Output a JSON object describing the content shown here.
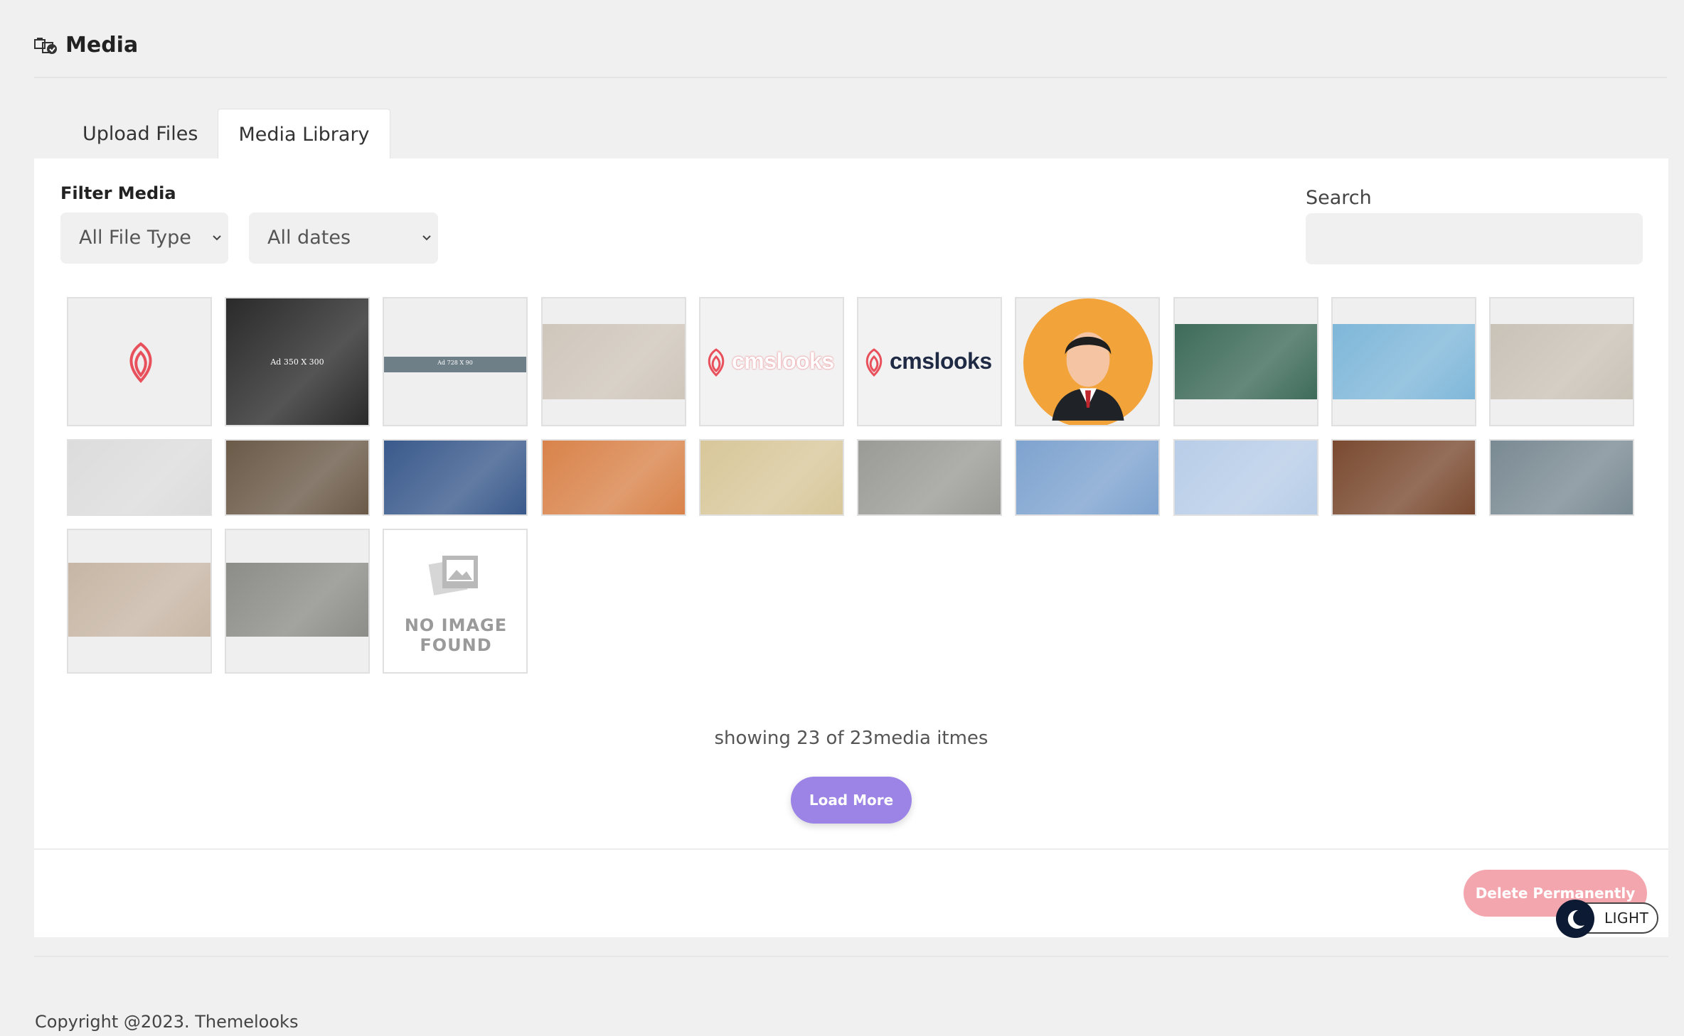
{
  "header": {
    "title": "Media",
    "icon": "media-icon"
  },
  "tabs": [
    {
      "label": "Upload Files",
      "active": false
    },
    {
      "label": "Media Library",
      "active": true
    }
  ],
  "filter": {
    "label": "Filter Media",
    "file_type": "All File Type",
    "dates": "All dates"
  },
  "search": {
    "label": "Search",
    "placeholder": "",
    "value": ""
  },
  "media": {
    "items": [
      {
        "kind": "logo-mark",
        "bg": "#efefef"
      },
      {
        "kind": "photo",
        "bg": "#2a2a2a",
        "label": "Ad 350 X 300"
      },
      {
        "kind": "banner",
        "bg": "#efefef",
        "label": "Ad 728 X 90"
      },
      {
        "kind": "photo",
        "bg": "#cfc6bb"
      },
      {
        "kind": "logo-text",
        "bg": "#f2f2f2",
        "label": "cmslooks"
      },
      {
        "kind": "logo-text",
        "bg": "#f2f2f2",
        "label": "cmslooks"
      },
      {
        "kind": "avatar",
        "bg": "#efefef"
      },
      {
        "kind": "photo",
        "bg": "#3e6b5a"
      },
      {
        "kind": "photo",
        "bg": "#7fb7d9"
      },
      {
        "kind": "photo",
        "bg": "#c9c2b7"
      },
      {
        "kind": "photo",
        "bg": "#dcdcdc"
      },
      {
        "kind": "photo",
        "bg": "#6b5a48"
      },
      {
        "kind": "photo",
        "bg": "#3a5a8c"
      },
      {
        "kind": "photo",
        "bg": "#d9834a"
      },
      {
        "kind": "photo",
        "bg": "#d8c79a"
      },
      {
        "kind": "photo",
        "bg": "#9a9a96"
      },
      {
        "kind": "photo",
        "bg": "#7ea3cf"
      },
      {
        "kind": "photo",
        "bg": "#b8cde8"
      },
      {
        "kind": "photo",
        "bg": "#7a4a30"
      },
      {
        "kind": "photo",
        "bg": "#7a8a93"
      },
      {
        "kind": "photo",
        "bg": "#c7b6a5"
      },
      {
        "kind": "photo",
        "bg": "#8c8c88"
      },
      {
        "kind": "no-image",
        "bg": "#ffffff",
        "label": "NO IMAGE FOUND"
      }
    ],
    "showing_text": "showing 23 of 23media itmes",
    "load_more": "Load More",
    "delete": "Delete Permanently"
  },
  "theme": {
    "label": "LIGHT"
  },
  "footer": {
    "copyright": "Copyright @2023. Themelooks"
  },
  "colors": {
    "accent": "#9b84e6",
    "danger": "#f4a6ae",
    "brand": "#e8505b"
  }
}
